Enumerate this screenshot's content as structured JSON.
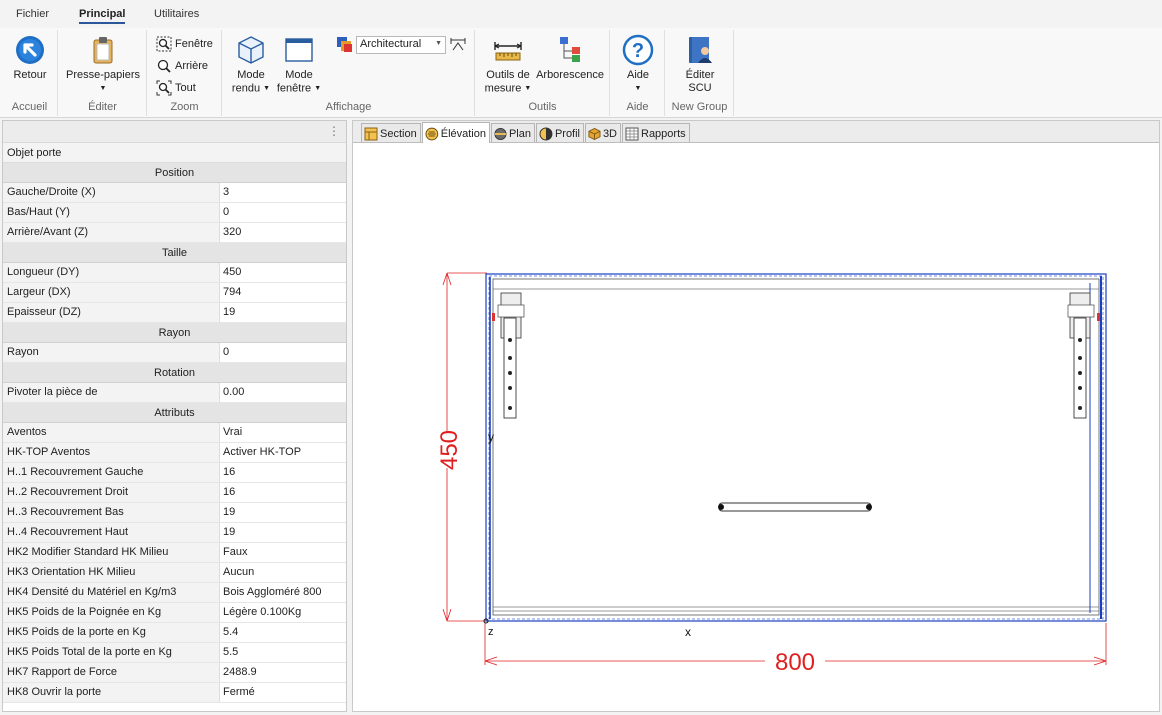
{
  "menu": {
    "tabs": [
      "Fichier",
      "Principal",
      "Utilitaires"
    ],
    "active": "Principal"
  },
  "ribbon": {
    "accueil": {
      "label": "Accueil",
      "retour": "Retour"
    },
    "editer": {
      "label": "Éditer",
      "presse": "Presse-papiers"
    },
    "zoom": {
      "label": "Zoom",
      "fenetre": "Fenêtre",
      "arriere": "Arrière",
      "tout": "Tout"
    },
    "affichage": {
      "label": "Affichage",
      "mode_rendu_1": "Mode",
      "mode_rendu_2": "rendu",
      "mode_fenetre_1": "Mode",
      "mode_fenetre_2": "fenêtre",
      "style": "Architectural"
    },
    "outils": {
      "label": "Outils",
      "mesure_1": "Outils de",
      "mesure_2": "mesure",
      "arbo": "Arborescence"
    },
    "aide": {
      "label": "Aide",
      "btn": "Aide"
    },
    "newgroup": {
      "label": "New Group",
      "btn_1": "Éditer",
      "btn_2": "SCU"
    }
  },
  "panel": {
    "title": "Objet porte",
    "sections": {
      "position": "Position",
      "taille": "Taille",
      "rayon": "Rayon",
      "rotation": "Rotation",
      "attributs": "Attributs"
    },
    "position": [
      {
        "k": "Gauche/Droite (X)",
        "v": "3"
      },
      {
        "k": "Bas/Haut (Y)",
        "v": "0"
      },
      {
        "k": "Arrière/Avant (Z)",
        "v": "320"
      }
    ],
    "taille": [
      {
        "k": "Longueur (DY)",
        "v": "450"
      },
      {
        "k": "Largeur (DX)",
        "v": "794"
      },
      {
        "k": "Epaisseur (DZ)",
        "v": "19"
      }
    ],
    "rayon": [
      {
        "k": "Rayon",
        "v": "0"
      }
    ],
    "rotation": [
      {
        "k": "Pivoter la pièce de",
        "v": "0.00"
      }
    ],
    "attributs": [
      {
        "k": " Aventos",
        "v": "Vrai"
      },
      {
        "k": " HK-TOP Aventos",
        "v": "Activer HK-TOP"
      },
      {
        "k": "H..1 Recouvrement Gauche",
        "v": "16"
      },
      {
        "k": "H..2 Recouvrement Droit",
        "v": "16"
      },
      {
        "k": "H..3 Recouvrement Bas",
        "v": "19"
      },
      {
        "k": "H..4 Recouvrement Haut",
        "v": "19"
      },
      {
        "k": "HK2 Modifier Standard HK Milieu",
        "v": "Faux"
      },
      {
        "k": "HK3 Orientation HK Milieu",
        "v": "Aucun"
      },
      {
        "k": "HK4 Densité du Matériel en Kg/m3",
        "v": "Bois Aggloméré 800"
      },
      {
        "k": "HK5 Poids de la Poignée en Kg",
        "v": "Légère 0.100Kg"
      },
      {
        "k": "HK5 Poids de la porte en Kg",
        "v": "5.4"
      },
      {
        "k": "HK5 Poids Total de la porte en Kg",
        "v": "5.5"
      },
      {
        "k": "HK7 Rapport de Force",
        "v": "2488.9"
      },
      {
        "k": "HK8 Ouvrir la porte",
        "v": "Fermé"
      }
    ]
  },
  "view": {
    "tabs": [
      "Section",
      "Élévation",
      "Plan",
      "Profil",
      "3D",
      "Rapports"
    ],
    "active": "Élévation",
    "dim_height": "450",
    "dim_width": "800",
    "axis_y": "y",
    "axis_x": "x",
    "axis_z": "z"
  },
  "colors": {
    "dimension": "#e02020",
    "door_outline": "#1a3fbf",
    "accent": "#2b579a"
  }
}
